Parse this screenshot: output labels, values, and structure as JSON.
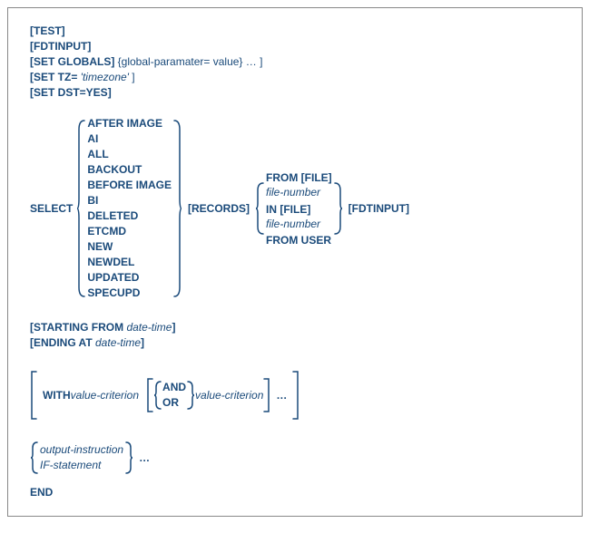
{
  "top": {
    "test": "[TEST]",
    "fdtinput": "[FDTINPUT]",
    "set_globals_label": "[SET GLOBALS]",
    "set_globals_rest": "  {global-paramater= value} … ]",
    "set_tz_label": "[SET TZ=",
    "set_tz_val": "   'timezone'",
    "set_tz_close": " ]",
    "set_dst": "[SET DST=YES]"
  },
  "select": {
    "keyword": "SELECT",
    "options": [
      "AFTER IMAGE",
      "AI",
      "ALL",
      "BACKOUT",
      "BEFORE IMAGE",
      "BI",
      "DELETED",
      "ETCMD",
      "NEW",
      "NEWDEL",
      "UPDATED",
      "SPECUPD"
    ],
    "records": "[RECORDS]",
    "from_opts": {
      "from_file_b": "FROM [FILE]",
      "from_file_i": " file-number",
      "in_file_b": "IN [FILE]",
      "in_file_i": " file-number",
      "from_user": "FROM USER"
    },
    "fdtinput": "[FDTINPUT]"
  },
  "starting": {
    "label": "[STARTING FROM",
    "val": "   date-time",
    "close": "]"
  },
  "ending": {
    "label": "[ENDING AT",
    "val": "   date-time",
    "close": "]"
  },
  "with": {
    "label": "WITH",
    "vc1": " value-criterion",
    "and": "AND",
    "or": "OR",
    "vc2": " value-criterion",
    "ellipsis": "…"
  },
  "output": {
    "line1": "output-instruction",
    "line2": "IF-statement",
    "ellipsis": "…"
  },
  "end": "END"
}
